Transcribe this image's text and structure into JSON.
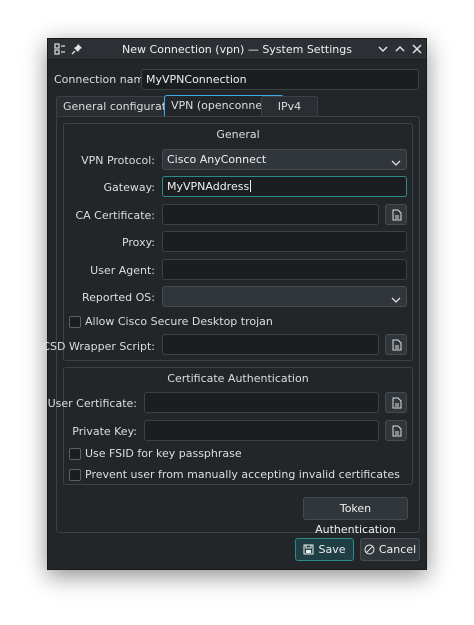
{
  "window": {
    "title": "New Connection (vpn) — System Settings"
  },
  "connection": {
    "name_label": "Connection name:",
    "name_value": "MyVPNConnection"
  },
  "tabs": [
    {
      "label": "General configuration",
      "active": false
    },
    {
      "label": "VPN (openconnect)",
      "active": true
    },
    {
      "label": "IPv4",
      "active": false
    }
  ],
  "general": {
    "title": "General",
    "vpn_protocol_label": "VPN Protocol:",
    "vpn_protocol_value": "Cisco AnyConnect",
    "gateway_label": "Gateway:",
    "gateway_value": "MyVPNAddress",
    "ca_certificate_label": "CA Certificate:",
    "ca_certificate_value": "",
    "proxy_label": "Proxy:",
    "proxy_value": "",
    "user_agent_label": "User Agent:",
    "user_agent_value": "",
    "reported_os_label": "Reported OS:",
    "reported_os_value": "",
    "allow_csd_label": "Allow Cisco Secure Desktop trojan",
    "allow_csd_checked": false,
    "csd_wrapper_label": "CSD Wrapper Script:",
    "csd_wrapper_value": ""
  },
  "cert_auth": {
    "title": "Certificate Authentication",
    "user_certificate_label": "User Certificate:",
    "user_certificate_value": "",
    "private_key_label": "Private Key:",
    "private_key_value": "",
    "fsid_label": "Use FSID for key passphrase",
    "fsid_checked": false,
    "prevent_invalid_label": "Prevent user from manually accepting invalid certificates",
    "prevent_invalid_checked": false
  },
  "token_button_label": "Token Authentication",
  "buttons": {
    "save_label": "Save",
    "cancel_label": "Cancel"
  },
  "colors": {
    "window_bg": "#232629",
    "field_bg": "#1b1e20",
    "accent": "#3daee9",
    "focus": "#2e8a8a"
  },
  "icons": [
    "app-menu-icon",
    "pin-icon",
    "minimize-chevron-icon",
    "maximize-chevron-icon",
    "close-icon",
    "file-open-icon",
    "save-icon",
    "cancel-icon",
    "chevron-down-icon"
  ]
}
